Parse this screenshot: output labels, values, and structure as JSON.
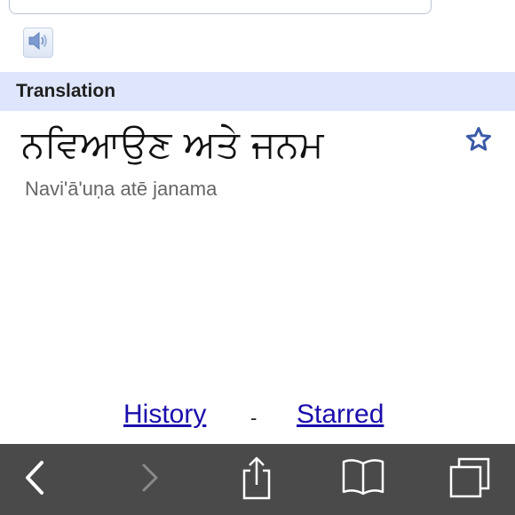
{
  "translation_section": {
    "header": "Translation",
    "text": "ਨਵਿਆਉਣ ਅਤੇ ਜਨਮ",
    "transliteration": "Navi'ā'uṇa atē janama"
  },
  "links": {
    "history": "History",
    "separator": "-",
    "starred": "Starred"
  },
  "icons": {
    "speaker": "speaker-icon",
    "star": "star-icon",
    "back": "back-chevron-icon",
    "forward": "forward-chevron-icon",
    "share": "share-icon",
    "bookmarks": "bookmarks-icon",
    "tabs": "tabs-icon"
  },
  "colors": {
    "header_bg": "#dfe6fb",
    "link": "#1a0dab",
    "toolbar_bg": "#4a4a4a",
    "star": "#3b5aa8"
  }
}
